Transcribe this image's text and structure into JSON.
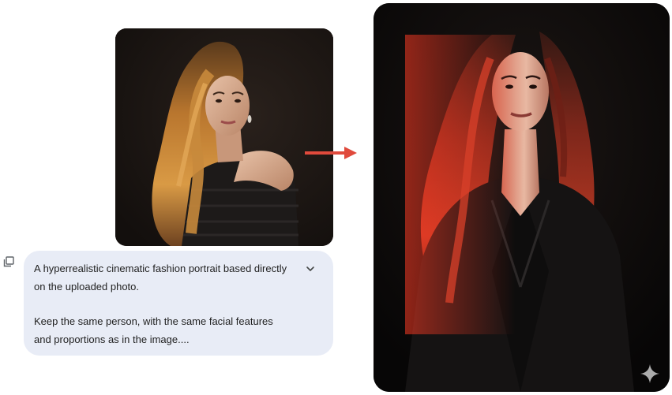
{
  "prompt": {
    "line1": "A hyperrealistic cinematic fashion portrait based directly",
    "line2": "on the uploaded photo.",
    "line3": "Keep the same person, with the same facial features",
    "line4": "and proportions as in the image...."
  },
  "icons": {
    "copy": "copy-icon",
    "expand": "chevron-down-icon",
    "arrow": "arrow-right-icon",
    "sparkle": "gemini-sparkle-icon"
  },
  "colors": {
    "bubble_bg": "#e8ecf6",
    "arrow": "#e04a3c",
    "text": "#1f1f1f"
  }
}
